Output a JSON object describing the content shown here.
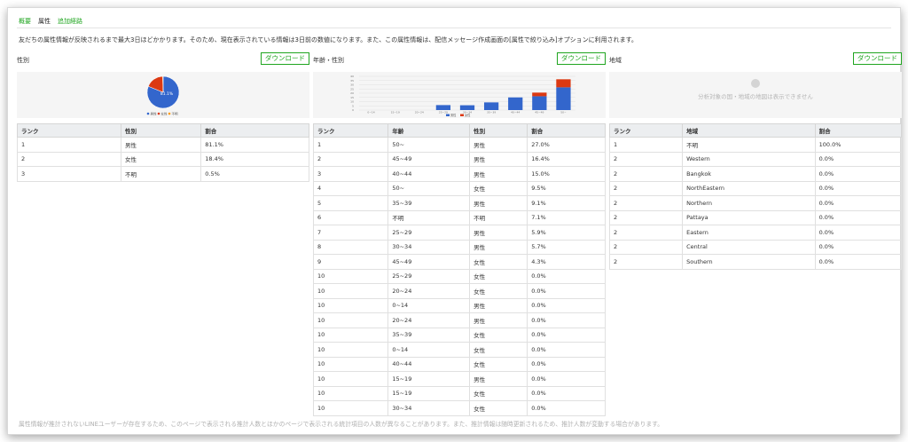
{
  "tabs": [
    {
      "label": "概要",
      "active": false
    },
    {
      "label": "属性",
      "active": true
    },
    {
      "label": "追加経路",
      "active": false
    }
  ],
  "notice": "友だちの属性情報が反映されるまで最大3日ほどかかります。そのため、現在表示されている情報は3日前の数値になります。また、この属性情報は、配信メッセージ作成画面の[属性で絞り込み]オプションに利用されます。",
  "download_label": "ダウンロード",
  "gender": {
    "title": "性別",
    "headers": [
      "ランク",
      "性別",
      "割合"
    ],
    "rows": [
      [
        "1",
        "男性",
        "81.1%"
      ],
      [
        "2",
        "女性",
        "18.4%"
      ],
      [
        "3",
        "不明",
        "0.5%"
      ]
    ]
  },
  "age_gender": {
    "title": "年齢・性別",
    "headers": [
      "ランク",
      "年齢",
      "性別",
      "割合"
    ],
    "rows": [
      [
        "1",
        "50~",
        "男性",
        "27.0%"
      ],
      [
        "2",
        "45~49",
        "男性",
        "16.4%"
      ],
      [
        "3",
        "40~44",
        "男性",
        "15.0%"
      ],
      [
        "4",
        "50~",
        "女性",
        "9.5%"
      ],
      [
        "5",
        "35~39",
        "男性",
        "9.1%"
      ],
      [
        "6",
        "不明",
        "不明",
        "7.1%"
      ],
      [
        "7",
        "25~29",
        "男性",
        "5.9%"
      ],
      [
        "8",
        "30~34",
        "男性",
        "5.7%"
      ],
      [
        "9",
        "45~49",
        "女性",
        "4.3%"
      ],
      [
        "10",
        "25~29",
        "女性",
        "0.0%"
      ],
      [
        "10",
        "20~24",
        "女性",
        "0.0%"
      ],
      [
        "10",
        "0~14",
        "男性",
        "0.0%"
      ],
      [
        "10",
        "20~24",
        "男性",
        "0.0%"
      ],
      [
        "10",
        "35~39",
        "女性",
        "0.0%"
      ],
      [
        "10",
        "0~14",
        "女性",
        "0.0%"
      ],
      [
        "10",
        "40~44",
        "女性",
        "0.0%"
      ],
      [
        "10",
        "15~19",
        "男性",
        "0.0%"
      ],
      [
        "10",
        "15~19",
        "女性",
        "0.0%"
      ],
      [
        "10",
        "30~34",
        "女性",
        "0.0%"
      ]
    ]
  },
  "region": {
    "title": "地域",
    "no_map_text": "分析対象の国・地域の地図は表示できません",
    "headers": [
      "ランク",
      "地域",
      "割合"
    ],
    "rows": [
      [
        "1",
        "不明",
        "100.0%"
      ],
      [
        "2",
        "Western",
        "0.0%"
      ],
      [
        "2",
        "Bangkok",
        "0.0%"
      ],
      [
        "2",
        "NorthEastern",
        "0.0%"
      ],
      [
        "2",
        "Northern",
        "0.0%"
      ],
      [
        "2",
        "Pattaya",
        "0.0%"
      ],
      [
        "2",
        "Eastern",
        "0.0%"
      ],
      [
        "2",
        "Central",
        "0.0%"
      ],
      [
        "2",
        "Southern",
        "0.0%"
      ]
    ]
  },
  "chart_data": [
    {
      "type": "pie",
      "labels": [
        "男性",
        "女性",
        "不明"
      ],
      "values": [
        81.1,
        18.4,
        0.5
      ],
      "colors": [
        "#3366cc",
        "#dc3912",
        "#ff9900"
      ],
      "data_label": "81.1%",
      "legend_position": "bottom"
    },
    {
      "type": "bar",
      "stacked": true,
      "categories": [
        "0~14",
        "15~19",
        "20~24",
        "25~29",
        "30~34",
        "35~39",
        "40~44",
        "45~49",
        "50~"
      ],
      "series": [
        {
          "name": "男性",
          "color": "#3366cc",
          "values": [
            0.0,
            0.0,
            0.0,
            5.9,
            5.7,
            9.1,
            15.0,
            16.4,
            27.0
          ]
        },
        {
          "name": "女性",
          "color": "#dc3912",
          "values": [
            0.0,
            0.0,
            0.0,
            0.0,
            0.0,
            0.0,
            0.0,
            4.3,
            9.5
          ]
        }
      ],
      "ylim": [
        0,
        40
      ],
      "yticks": [
        0,
        5,
        10,
        15,
        20,
        25,
        30,
        35,
        40
      ],
      "grid": true,
      "legend_position": "bottom"
    }
  ]
}
